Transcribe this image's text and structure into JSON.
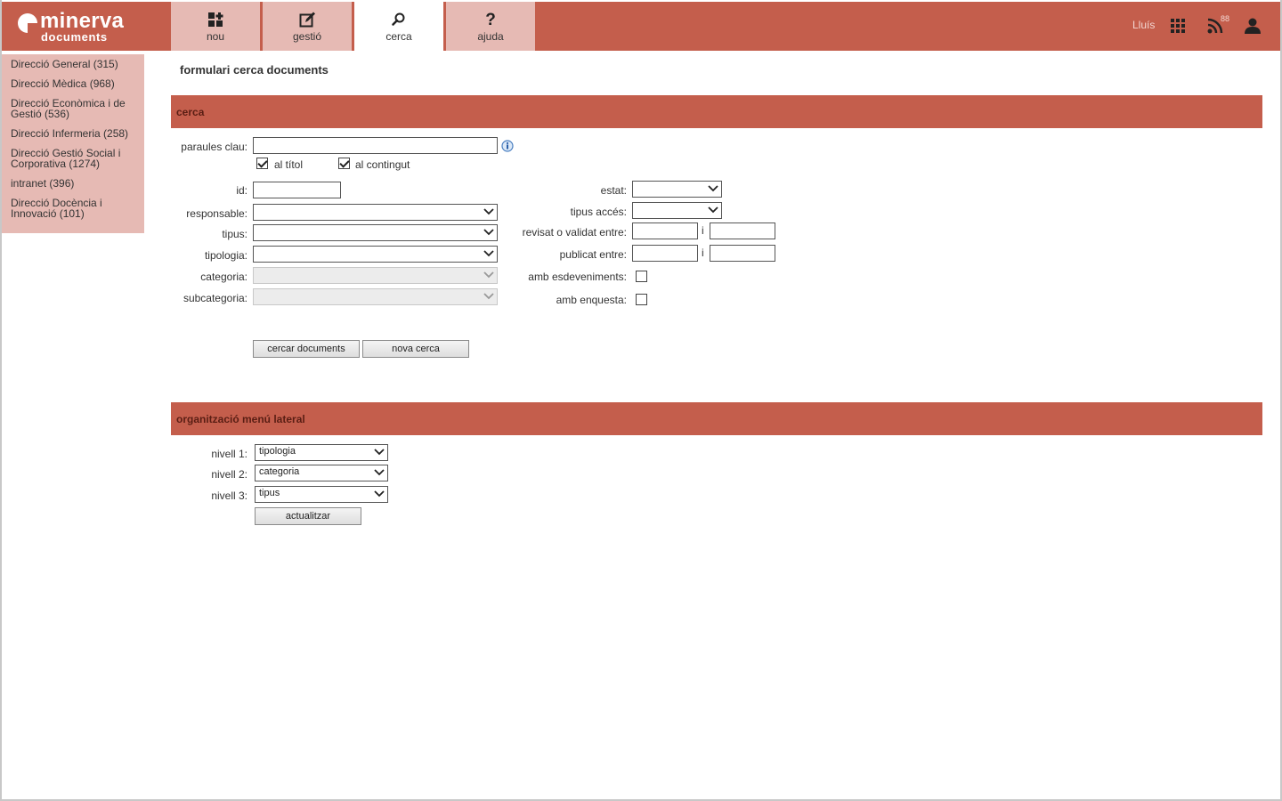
{
  "app": {
    "logo_name": "minerva",
    "logo_sub": "documents",
    "accent_color": "#c45e4c",
    "tab_color": "#e6bab4"
  },
  "tabs": [
    {
      "label": "nou",
      "icon": "add-grid-icon"
    },
    {
      "label": "gestió",
      "icon": "edit-icon"
    },
    {
      "label": "cerca",
      "icon": "search-icon",
      "active": true
    },
    {
      "label": "ajuda",
      "icon": "help-icon"
    }
  ],
  "header_right": {
    "user": "Lluís",
    "rss_badge": "88",
    "icons": [
      "apps-grid-icon",
      "rss-icon",
      "user-icon"
    ]
  },
  "sidebar": {
    "items": [
      {
        "label": "Direcció General (315)"
      },
      {
        "label": "Direcció Mèdica (968)"
      },
      {
        "label": "Direcció Econòmica i de Gestió (536)"
      },
      {
        "label": "Direcció Infermeria (258)"
      },
      {
        "label": "Direcció Gestió Social i Corporativa (1274)"
      },
      {
        "label": "intranet (396)"
      },
      {
        "label": "Direcció Docència i Innovació (101)"
      }
    ]
  },
  "main": {
    "title": "formulari cerca documents",
    "search_section": "cerca",
    "fields": {
      "keywords_label": "paraules clau:",
      "keywords_value": "",
      "in_title_label": "al títol",
      "in_title_checked": true,
      "in_content_label": "al contingut",
      "in_content_checked": true,
      "id_label": "id:",
      "responsable_label": "responsable:",
      "tipus_label": "tipus:",
      "tipologia_label": "tipologia:",
      "categoria_label": "categoria:",
      "subcategoria_label": "subcategoria:",
      "estat_label": "estat:",
      "tipus_acces_label": "tipus accés:",
      "revisat_label": "revisat o validat entre:",
      "publicat_label": "publicat entre:",
      "between_sep": "i",
      "esdeveniments_label": "amb esdeveniments:",
      "esdeveniments_checked": false,
      "enquesta_label": "amb enquesta:",
      "enquesta_checked": false
    },
    "buttons": {
      "search": "cercar documents",
      "new_search": "nova cerca"
    },
    "menu_section": "organització menú lateral",
    "levels": [
      {
        "label": "nivell 1:",
        "value": "tipologia"
      },
      {
        "label": "nivell 2:",
        "value": "categoria"
      },
      {
        "label": "nivell 3:",
        "value": "tipus"
      }
    ],
    "update_button": "actualitzar"
  }
}
